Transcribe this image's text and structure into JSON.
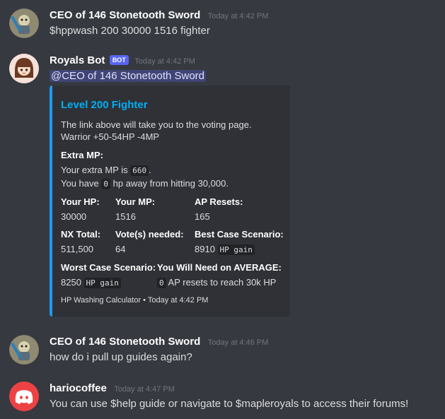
{
  "messages": [
    {
      "author": "CEO of 146 Stonetooth Sword",
      "timestamp": "Today at 4:42 PM",
      "text": "$hppwash 200 30000 1516 fighter"
    },
    {
      "author": "Royals Bot",
      "bot_tag": "BOT",
      "timestamp": "Today at 4:42 PM",
      "mention": "@CEO of 146 Stonetooth Sword",
      "embed": {
        "accent_color": "#1e9bf0",
        "title": "Level 200 Fighter",
        "description_line1": "The link above will take you to the voting page.",
        "description_line2": "Warrior +50-54HP -4MP",
        "extra_mp": {
          "heading": "Extra MP:",
          "line1_pre": "Your extra MP is",
          "line1_code": "660",
          "line1_post": ".",
          "line2_pre": "You have",
          "line2_code": "0",
          "line2_post": "hp away from hitting 30,000."
        },
        "fields": [
          {
            "name": "Your HP:",
            "value": "30000"
          },
          {
            "name": "Your MP:",
            "value": "1516"
          },
          {
            "name": "AP Resets:",
            "value": "165"
          },
          {
            "name": "NX Total:",
            "value": "511,500"
          },
          {
            "name": "Vote(s) needed:",
            "value": "64"
          },
          {
            "name": "Best Case Scenario:",
            "value": "8910",
            "code": "HP gain"
          },
          {
            "name": "Worst Case Scenario:",
            "value": "8250",
            "code": "HP gain"
          },
          {
            "name": "You Will Need on AVERAGE:",
            "code_pre": "0",
            "value": "AP resets to reach 30k HP"
          }
        ],
        "footer": "HP Washing Calculator • Today at 4:42 PM"
      }
    },
    {
      "author": "CEO of 146 Stonetooth Sword",
      "timestamp": "Today at 4:46 PM",
      "text": "how do i pull up guides again?"
    },
    {
      "author": "hariocoffee",
      "timestamp": "Today at 4:47 PM",
      "text": "You can use $help guide or navigate to $mapleroyals to access their forums!"
    }
  ]
}
